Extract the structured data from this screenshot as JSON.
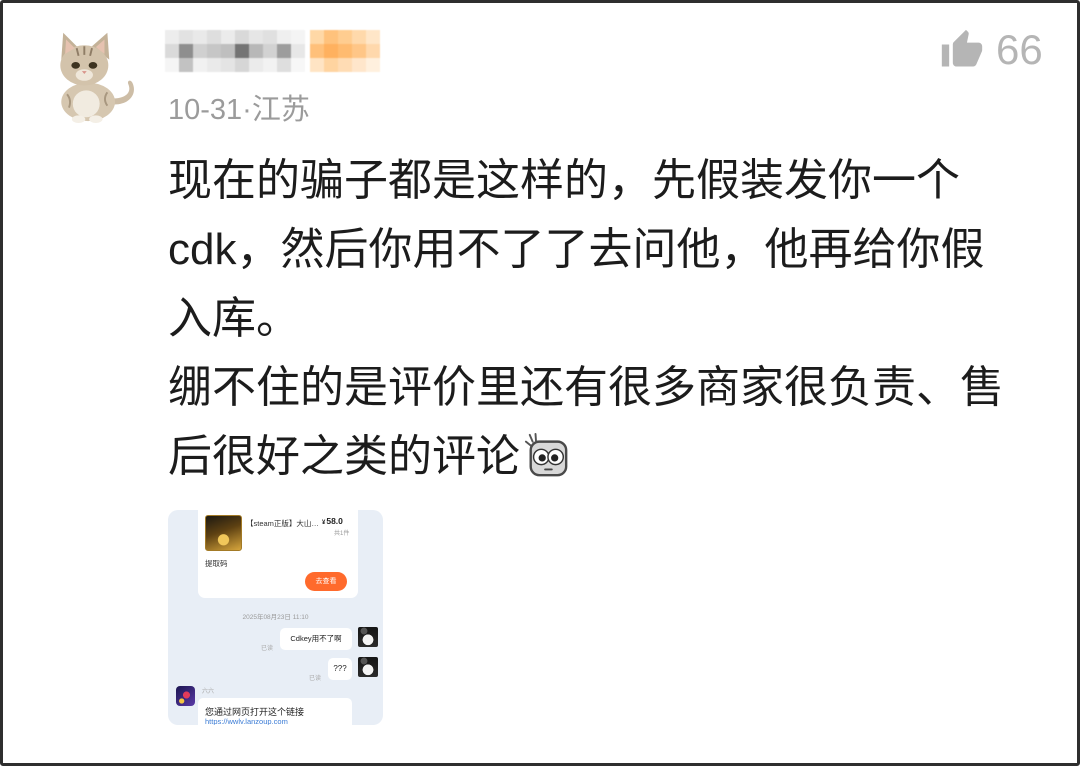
{
  "colors": {
    "text": "#1c1c1c",
    "meta": "#9b9b9b",
    "like": "#b5b5b5",
    "accent_orange": "#ff6a2c",
    "image_background": "#e8eef6",
    "link": "#3a7bd5"
  },
  "comment": {
    "avatar_icon": "cat-avatar",
    "date": "10-31",
    "separator": "·",
    "location": "江苏",
    "like_icon": "thumbs-up-icon",
    "like_count": "66",
    "lines": [
      "现在的骗子都是这样的，先假装发你一个",
      "cdk，然后你用不了了去问他，他再给你假",
      "入库。",
      "绷不住的是评价里还有很多商家很负责、售",
      "后很好之类的评论"
    ],
    "emoji_icon": "staring-face-emoji",
    "attached_image": {
      "order_card": {
        "title": "【steam正版】大山…",
        "price_symbol": "¥",
        "price": "58.0",
        "quantity": "共1件",
        "code_label": "提取码",
        "button_label": "去查看"
      },
      "timestamp": "2025年08月23日 11:10",
      "sent_messages": [
        {
          "text": "Cdkey用不了啊",
          "status": "已读"
        },
        {
          "text": "???",
          "status": "已读"
        }
      ],
      "received_message": {
        "sender": "六六",
        "text": "您通过网页打开这个链接",
        "link": "https://wwlv.lanzoup.com"
      }
    }
  }
}
